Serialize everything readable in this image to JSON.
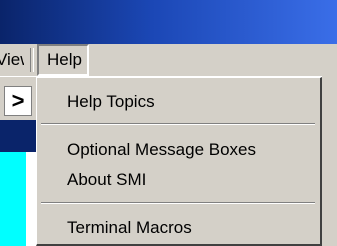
{
  "menubar": {
    "view_label": "View",
    "help_label": "Help"
  },
  "background": {
    "toolbar_glyph": ">"
  },
  "help_menu": {
    "items": [
      {
        "label": "Help Topics"
      },
      {
        "label": "Optional Message Boxes"
      },
      {
        "label": "About SMI"
      },
      {
        "label": "Terminal Macros"
      }
    ]
  }
}
